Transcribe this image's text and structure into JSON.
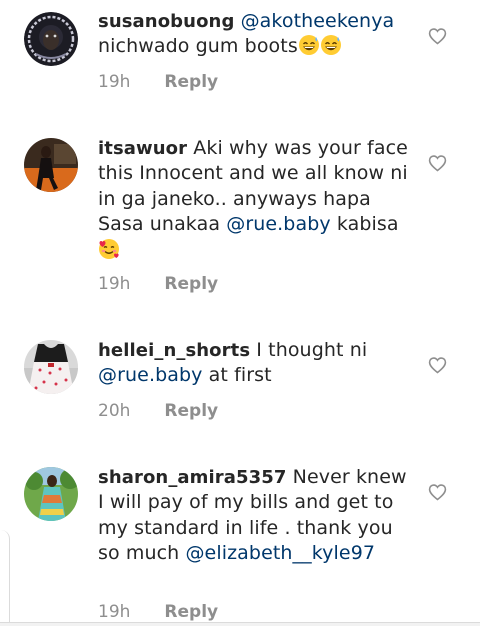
{
  "comments": [
    {
      "username": "susanobuong",
      "text_parts": [
        "",
        "@akotheekenya",
        " nichwado gum boots",
        "😅😅"
      ],
      "time": "19h",
      "reply_label": "Reply",
      "avatar_icon": "avatar-dark-logo"
    },
    {
      "username": "itsawuor",
      "text_parts": [
        " Aki why was your face this Innocent and we all know ni in ga janeko.. anyways hapa Sasa unakaa ",
        "@rue.baby",
        " kabisa",
        "🥰"
      ],
      "time": "19h",
      "reply_label": "Reply",
      "avatar_icon": "avatar-person-orange"
    },
    {
      "username": "hellei_n_shorts",
      "text_parts": [
        " I thought ni ",
        "@rue.baby",
        " at first"
      ],
      "time": "20h",
      "reply_label": "Reply",
      "avatar_icon": "avatar-polka-dress"
    },
    {
      "username": "sharon_amira5357",
      "text_parts": [
        " Never knew I will pay of my bills and get to my standard in life . thank you so much ",
        "@elizabeth__kyle97"
      ],
      "time": "19h",
      "reply_label": "Reply",
      "avatar_icon": "avatar-woman-outdoors"
    }
  ],
  "colors": {
    "text": "#262626",
    "mention": "#00376b",
    "meta": "#8e8e8e"
  },
  "icons": {
    "like": "heart-outline-icon",
    "emoji_sweat": "grinning-sweat-emoji",
    "emoji_hearts": "smiling-hearts-emoji"
  }
}
